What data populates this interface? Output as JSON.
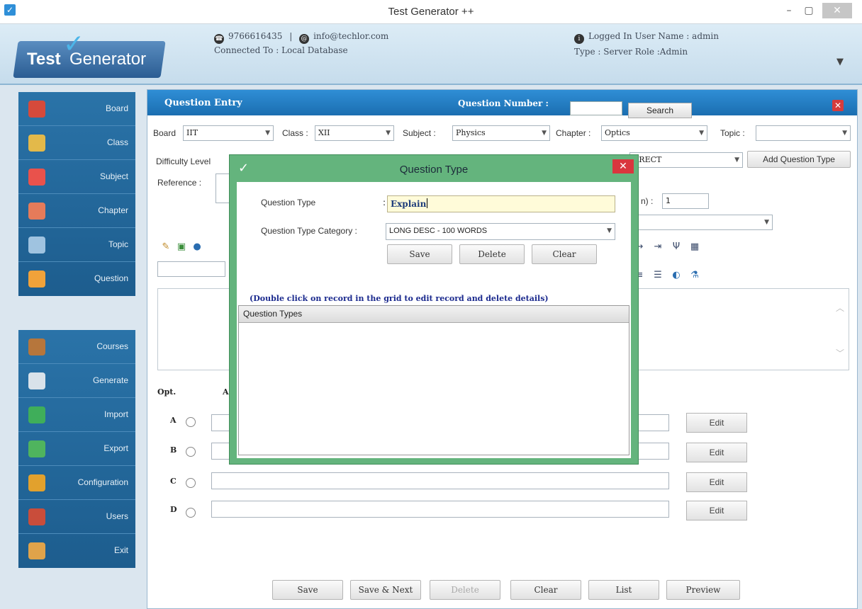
{
  "window": {
    "title": "Test Generator ++",
    "min": "–",
    "max": "▢",
    "close": "✕"
  },
  "header": {
    "logo_test": "Test",
    "logo_generator": "Generator",
    "phone": "9766616435",
    "separator": "|",
    "email": "info@techlor.com",
    "connected": "Connected To :  Local Database",
    "logged_in": "Logged In User Name : admin",
    "type_role": "Type : Server     Role :Admin"
  },
  "sidebar": {
    "items_top": [
      "Board",
      "Class",
      "Subject",
      "Chapter",
      "Topic",
      "Question"
    ],
    "items_bottom": [
      "Courses",
      "Generate",
      "Import",
      "Export",
      "Configuration",
      "Users",
      "Exit"
    ]
  },
  "question_entry": {
    "title": "Question Entry",
    "question_number_label": "Question Number :",
    "search_label": "Search",
    "board_label": "Board",
    "board_value": "IIT",
    "class_label": "Class :",
    "class_value": "XII",
    "subject_label": "Subject :",
    "subject_value": "Physics",
    "chapter_label": "Chapter :",
    "chapter_value": "Optics",
    "topic_label": "Topic :",
    "topic_value": "",
    "difficulty_label": "Difficulty Level",
    "qtype_value_partial": "RRECT",
    "add_qtype_label": "Add Question Type",
    "reference_label": "Reference :",
    "marks_label_partial": "n) :",
    "marks_value": "1",
    "opt_header": "Opt.",
    "ans_header_partial": "A",
    "options": [
      "A",
      "B",
      "C",
      "D"
    ],
    "edit_label": "Edit",
    "buttons": {
      "save": "Save",
      "save_next": "Save & Next",
      "delete": "Delete",
      "clear": "Clear",
      "list": "List",
      "preview": "Preview"
    }
  },
  "modal": {
    "title": "Question Type",
    "qtype_label": "Question Type",
    "colon": ":",
    "qtype_value": "Explain",
    "category_label": "Question Type Category :",
    "category_value": "LONG DESC - 100 WORDS",
    "save": "Save",
    "delete": "Delete",
    "clear": "Clear",
    "note": "(Double click on record in the grid to edit record and delete details)",
    "grid_header": "Question Types"
  },
  "colors": {
    "accent_blue": "#1b6eb0",
    "sidebar_blue": "#1d5d8e",
    "modal_green": "#64b47d",
    "close_red": "#d9363e"
  }
}
